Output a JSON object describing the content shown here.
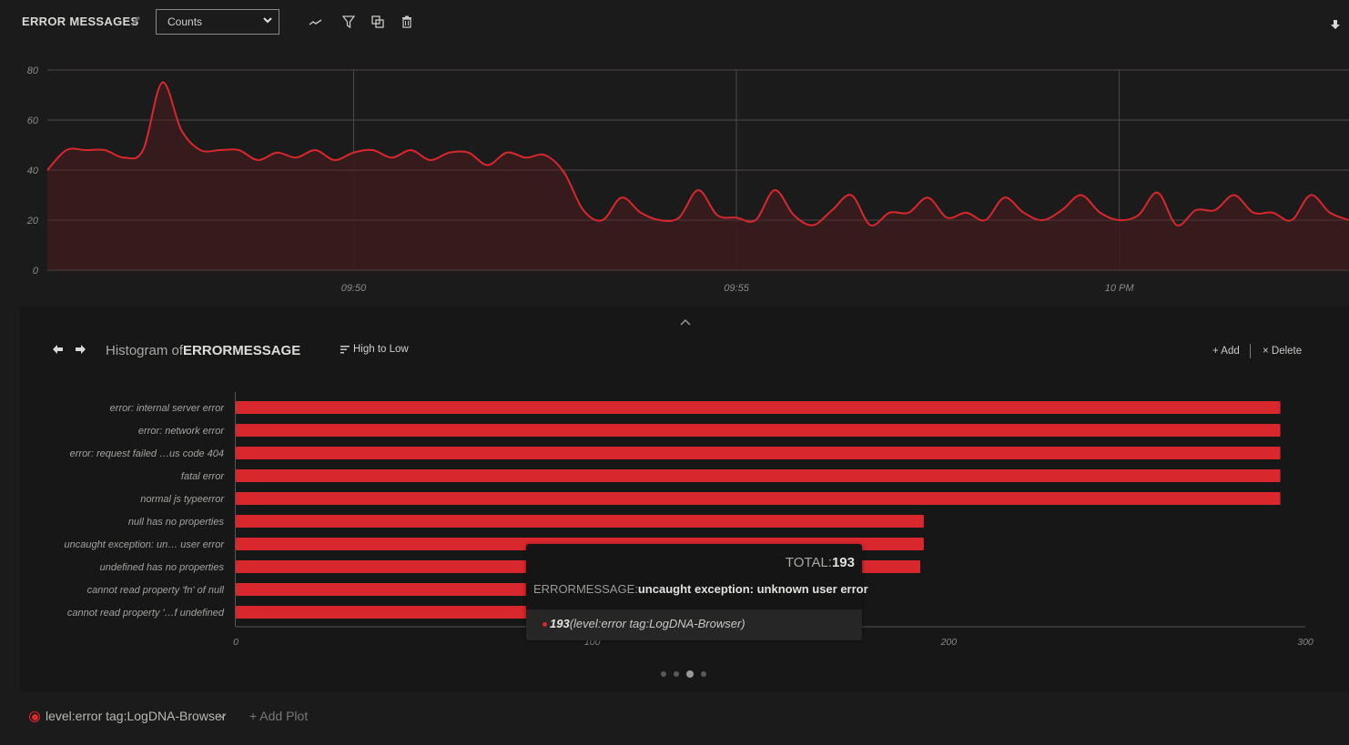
{
  "header": {
    "title": "ERROR MESSAGES",
    "select_value": "Counts",
    "icons": [
      "edit-icon",
      "line-chart-icon",
      "filter-icon",
      "duplicate-icon",
      "trash-icon",
      "download-icon"
    ]
  },
  "colors": {
    "accent": "#d9272e",
    "area_fill": "#3a1c1e",
    "background": "#1b1b1b",
    "panel_background": "#171717",
    "grid": "#4a4a48"
  },
  "chart_data": [
    {
      "type": "area",
      "title": "ERROR MESSAGES",
      "xlabel": "",
      "ylabel": "",
      "ylim": [
        0,
        80
      ],
      "yticks": [
        "0",
        "20",
        "40",
        "60",
        "80"
      ],
      "xtick_labels": [
        "09:50",
        "09:55",
        "10 PM"
      ],
      "grid": true,
      "interval_seconds": 15,
      "xtick_indices": [
        16,
        36,
        56
      ],
      "series": [
        {
          "name": "level:error tag:LogDNA-Browser",
          "values": [
            40,
            48,
            48,
            48,
            45,
            48,
            75,
            56,
            48,
            48,
            48,
            44,
            47,
            45,
            48,
            44,
            47,
            48,
            45,
            48,
            44,
            47,
            47,
            42,
            47,
            45,
            46,
            39,
            24,
            20,
            29,
            23,
            20,
            21,
            32,
            22,
            21,
            20,
            32,
            22,
            18,
            24,
            30,
            18,
            23,
            23,
            29,
            21,
            23,
            20,
            29,
            23,
            20,
            24,
            30,
            23,
            20,
            22,
            31,
            18,
            24,
            24,
            30,
            23,
            23,
            20,
            30,
            23,
            20
          ]
        }
      ]
    },
    {
      "type": "bar",
      "orientation": "horizontal",
      "title": "Histogram of ERRORMESSAGE",
      "xlim": [
        0,
        300
      ],
      "xticks": [
        "0",
        "100",
        "200",
        "300"
      ],
      "categories": [
        "error: internal server error",
        "error: network error",
        "error: request failed …us code 404",
        "fatal error",
        "normal js typeerror",
        "null has no properties",
        "uncaught exception: un… user error",
        "undefined has no properties",
        "cannot read property 'fn' of null",
        "cannot read property '…f undefined"
      ],
      "values": [
        293,
        293,
        293,
        293,
        293,
        193,
        193,
        192,
        96,
        96
      ]
    }
  ],
  "histogram": {
    "title_prefix": "Histogram of",
    "title_field": "ERRORMESSAGE",
    "sort_label": "High to Low",
    "add_label": "+ Add",
    "delete_label": "× Delete",
    "pages": 4,
    "active_page": 3
  },
  "tooltip": {
    "total_label": "TOTAL:",
    "total_value": "193",
    "field_label": "ERRORMESSAGE:",
    "field_value": "uncaught exception: unknown user error",
    "row_value": "193",
    "row_series": "(level:error tag:LogDNA-Browser)"
  },
  "footer": {
    "series_label": "level:error tag:LogDNA-Browser",
    "add_plot_label": "+ Add Plot"
  }
}
